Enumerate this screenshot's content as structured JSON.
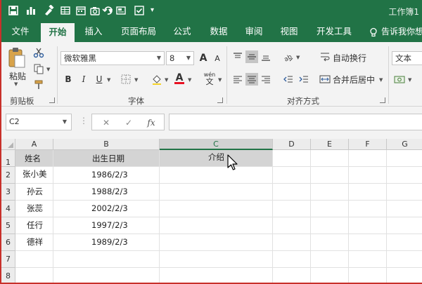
{
  "title_bar": {
    "app_title": "工作簿1"
  },
  "tabs": [
    "文件",
    "开始",
    "插入",
    "页面布局",
    "公式",
    "数据",
    "审阅",
    "视图",
    "开发工具"
  ],
  "active_tab": "开始",
  "tell_me": "告诉我你想",
  "ribbon": {
    "clipboard": {
      "paste_label": "粘贴",
      "group_label": "剪贴板"
    },
    "font": {
      "font_name": "微软雅黑",
      "font_size": "8",
      "group_label": "字体",
      "bold": "B",
      "italic": "I",
      "underline": "U",
      "color_glyph": "A",
      "grow": "A",
      "shrink": "A",
      "wen": "wén",
      "wen_char": "文"
    },
    "alignment": {
      "wrap_label": "自动换行",
      "merge_label": "合并后居中",
      "group_label": "对齐方式"
    },
    "number": {
      "format": "文本"
    },
    "accent_underline_color": "#e81123"
  },
  "formula_bar": {
    "name_box": "C2",
    "fx": "fx",
    "cancel": "✕",
    "enter": "✓",
    "content": ""
  },
  "grid": {
    "columns": [
      "A",
      "B",
      "C",
      "D",
      "E",
      "F",
      "G"
    ],
    "rows": [
      "1",
      "2",
      "3",
      "4",
      "5",
      "6",
      "7",
      "8"
    ],
    "selected_column": "C",
    "header": [
      "姓名",
      "出生日期",
      "介绍"
    ],
    "data": [
      [
        "张小美",
        "1986/2/3",
        ""
      ],
      [
        "孙云",
        "1988/2/3",
        ""
      ],
      [
        "张蕊",
        "2002/2/3",
        ""
      ],
      [
        "任行",
        "1997/2/3",
        ""
      ],
      [
        "德祥",
        "1989/2/3",
        ""
      ]
    ]
  },
  "colors": {
    "excel_green": "#217346",
    "frame_red": "#c8302a",
    "header_fill": "#d4d4d4"
  }
}
